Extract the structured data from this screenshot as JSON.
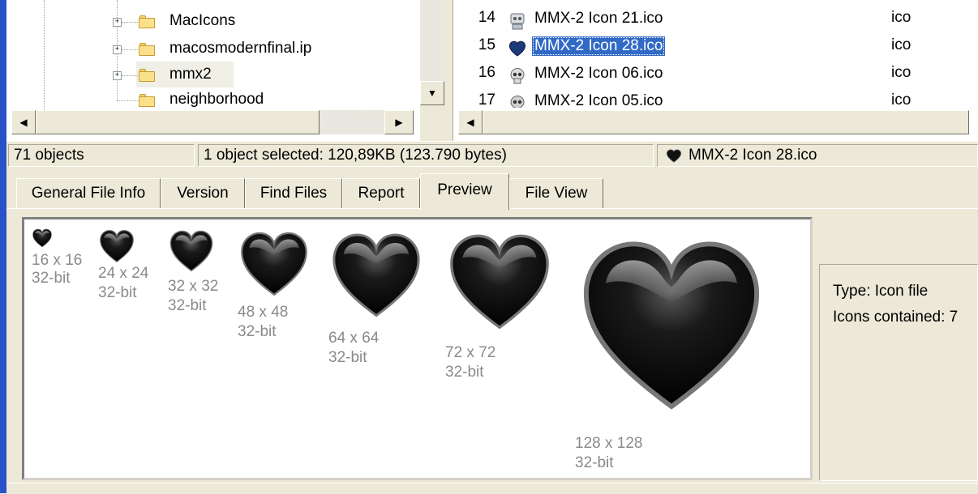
{
  "tree": {
    "items": [
      {
        "label": "MacIcons",
        "expander": "+"
      },
      {
        "label": "macosmodernfinal.ip",
        "expander": "+"
      },
      {
        "label": "mmx2",
        "expander": "+"
      },
      {
        "label": "neighborhood",
        "expander": ""
      }
    ]
  },
  "list": {
    "rows": [
      {
        "num": "14",
        "name": "MMX-2 Icon 21.ico",
        "type": "ico",
        "icon": "robot-icon"
      },
      {
        "num": "15",
        "name": "MMX-2 Icon 28.ico",
        "type": "ico",
        "icon": "heart-icon"
      },
      {
        "num": "16",
        "name": "MMX-2 Icon 06.ico",
        "type": "ico",
        "icon": "skull-icon"
      },
      {
        "num": "17",
        "name": "MMX-2 Icon 05.ico",
        "type": "ico",
        "icon": "skull-icon"
      }
    ]
  },
  "status": {
    "objects": "71 objects",
    "selection": "1 object selected: 120,89KB (123.790 bytes)",
    "file": "MMX-2 Icon 28.ico"
  },
  "tabs": [
    "General File Info",
    "Version",
    "Find Files",
    "Report",
    "Preview",
    "File View"
  ],
  "active_tab": "Preview",
  "preview": {
    "icons": [
      {
        "size": "16 x 16",
        "depth": "32-bit"
      },
      {
        "size": "24 x 24",
        "depth": "32-bit"
      },
      {
        "size": "32 x 32",
        "depth": "32-bit"
      },
      {
        "size": "48 x 48",
        "depth": "32-bit"
      },
      {
        "size": "64 x 64",
        "depth": "32-bit"
      },
      {
        "size": "72 x 72",
        "depth": "32-bit"
      },
      {
        "size": "128 x 128",
        "depth": "32-bit"
      }
    ]
  },
  "info": {
    "type": "Type: Icon file",
    "count": "Icons contained: 7"
  },
  "colors": {
    "selection": "#316ac5",
    "window_bg": "#ece9d8",
    "heart": "#111111"
  }
}
